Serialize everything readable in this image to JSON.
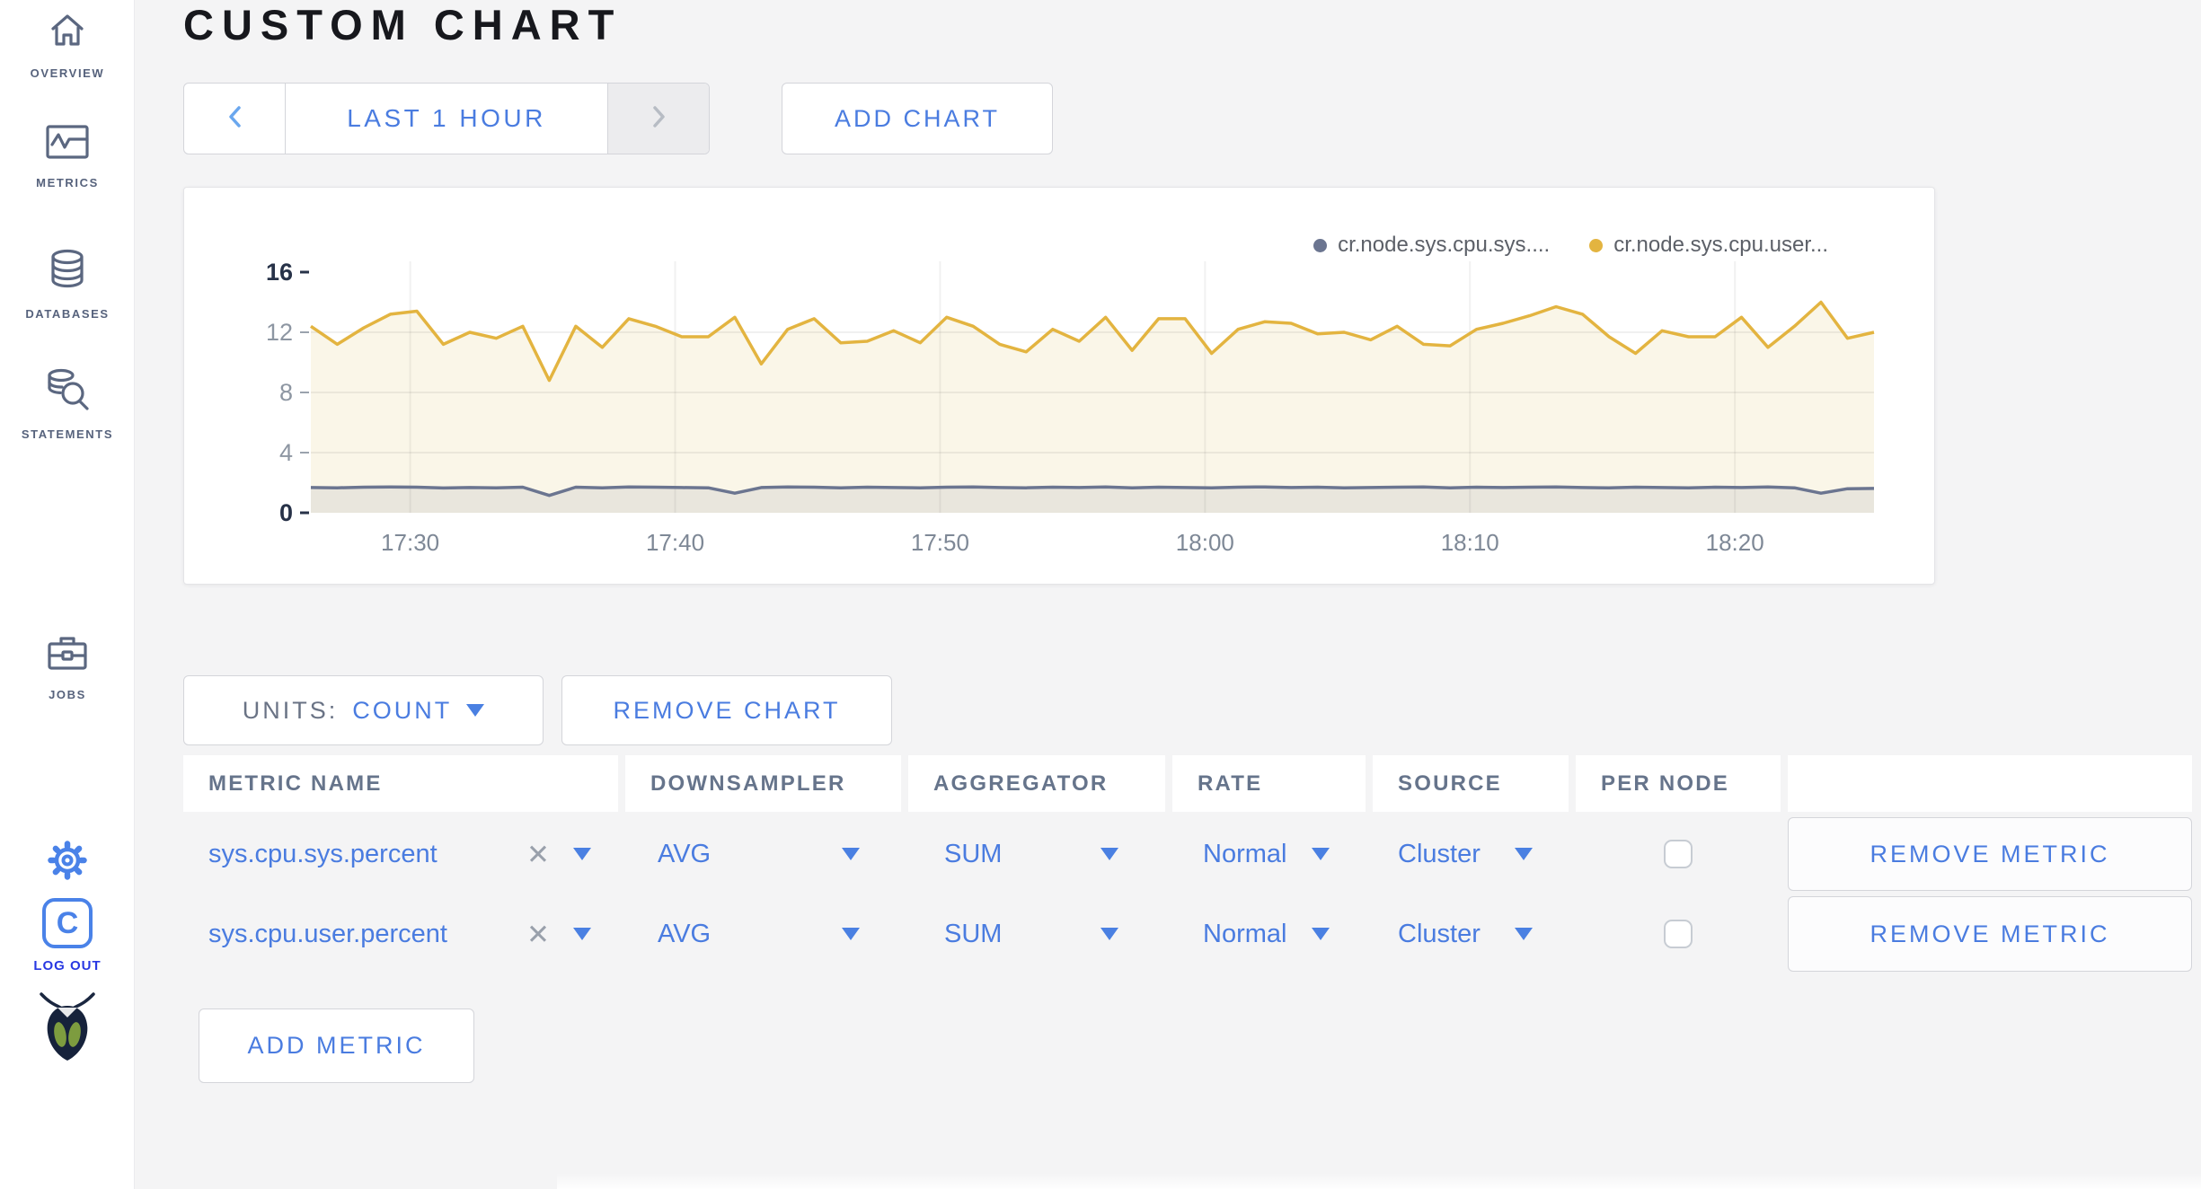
{
  "colors": {
    "accent_blue": "#4a7ce0",
    "logout_blue": "#2838e2",
    "sidebar_slate": "#56627c",
    "series_sys": "#6b7590",
    "series_user": "#e3b440",
    "fill_user": "#faf6e8",
    "fill_sys": "#e9e6dd"
  },
  "sidebar": {
    "items": [
      {
        "label": "OVERVIEW",
        "icon": "home-icon"
      },
      {
        "label": "METRICS",
        "icon": "metrics-icon"
      },
      {
        "label": "DATABASES",
        "icon": "database-icon"
      },
      {
        "label": "STATEMENTS",
        "icon": "statements-icon"
      },
      {
        "label": "JOBS",
        "icon": "jobs-icon"
      }
    ],
    "logout": {
      "badge": "C",
      "label": "LOG OUT"
    }
  },
  "header": {
    "title": "CUSTOM CHART"
  },
  "toolbar": {
    "time_range_label": "LAST 1 HOUR",
    "add_chart_label": "ADD CHART"
  },
  "chart_controls": {
    "units_label": "UNITS:",
    "units_value": "COUNT",
    "remove_chart_label": "REMOVE CHART",
    "add_metric_label": "ADD METRIC",
    "remove_metric_label": "REMOVE METRIC"
  },
  "table": {
    "headers": [
      "METRIC NAME",
      "DOWNSAMPLER",
      "AGGREGATOR",
      "RATE",
      "SOURCE",
      "PER NODE"
    ],
    "rows": [
      {
        "metric": "sys.cpu.sys.percent",
        "downsampler": "AVG",
        "aggregator": "SUM",
        "rate": "Normal",
        "source": "Cluster",
        "per_node": false
      },
      {
        "metric": "sys.cpu.user.percent",
        "downsampler": "AVG",
        "aggregator": "SUM",
        "rate": "Normal",
        "source": "Cluster",
        "per_node": false
      }
    ]
  },
  "chart_data": {
    "type": "line",
    "title": "",
    "xlabel": "",
    "ylabel": "",
    "ylim": [
      0,
      16
    ],
    "y_ticks": [
      0,
      4,
      8,
      12,
      16
    ],
    "x_ticks": [
      "17:30",
      "17:40",
      "17:50",
      "18:00",
      "18:10",
      "18:20"
    ],
    "x_window_min": 59,
    "x_first_tick_offset_min": 3.75,
    "x_tick_step_min": 10,
    "grid": true,
    "legend_position": "top-right",
    "series": [
      {
        "name": "cr.node.sys.cpu.sys....",
        "color": "#6b7590",
        "fill": "#e9e6dd",
        "values": [
          1.68,
          1.66,
          1.7,
          1.72,
          1.7,
          1.65,
          1.68,
          1.66,
          1.7,
          1.15,
          1.7,
          1.66,
          1.72,
          1.7,
          1.68,
          1.66,
          1.3,
          1.68,
          1.72,
          1.7,
          1.66,
          1.7,
          1.68,
          1.66,
          1.7,
          1.72,
          1.68,
          1.66,
          1.7,
          1.68,
          1.72,
          1.66,
          1.7,
          1.68,
          1.66,
          1.7,
          1.72,
          1.68,
          1.7,
          1.66,
          1.68,
          1.7,
          1.72,
          1.66,
          1.7,
          1.68,
          1.7,
          1.72,
          1.68,
          1.66,
          1.7,
          1.68,
          1.66,
          1.7,
          1.68,
          1.72,
          1.66,
          1.3,
          1.6,
          1.62
        ]
      },
      {
        "name": "cr.node.sys.cpu.user...",
        "color": "#e3b440",
        "fill": "#faf6e8",
        "values": [
          12.4,
          11.2,
          12.3,
          13.2,
          13.4,
          11.2,
          12.0,
          11.6,
          12.4,
          8.8,
          12.4,
          11.0,
          12.9,
          12.4,
          11.7,
          11.7,
          13.0,
          9.9,
          12.2,
          12.9,
          11.3,
          11.4,
          12.1,
          11.3,
          13.0,
          12.4,
          11.2,
          10.7,
          12.2,
          11.4,
          13.0,
          10.8,
          12.9,
          12.9,
          10.6,
          12.2,
          12.7,
          12.6,
          11.9,
          12.0,
          11.5,
          12.4,
          11.2,
          11.1,
          12.2,
          12.6,
          13.1,
          13.7,
          13.2,
          11.7,
          10.6,
          12.1,
          11.7,
          11.7,
          13.0,
          11.0,
          12.4,
          14.0,
          11.6,
          12.0
        ]
      }
    ]
  }
}
